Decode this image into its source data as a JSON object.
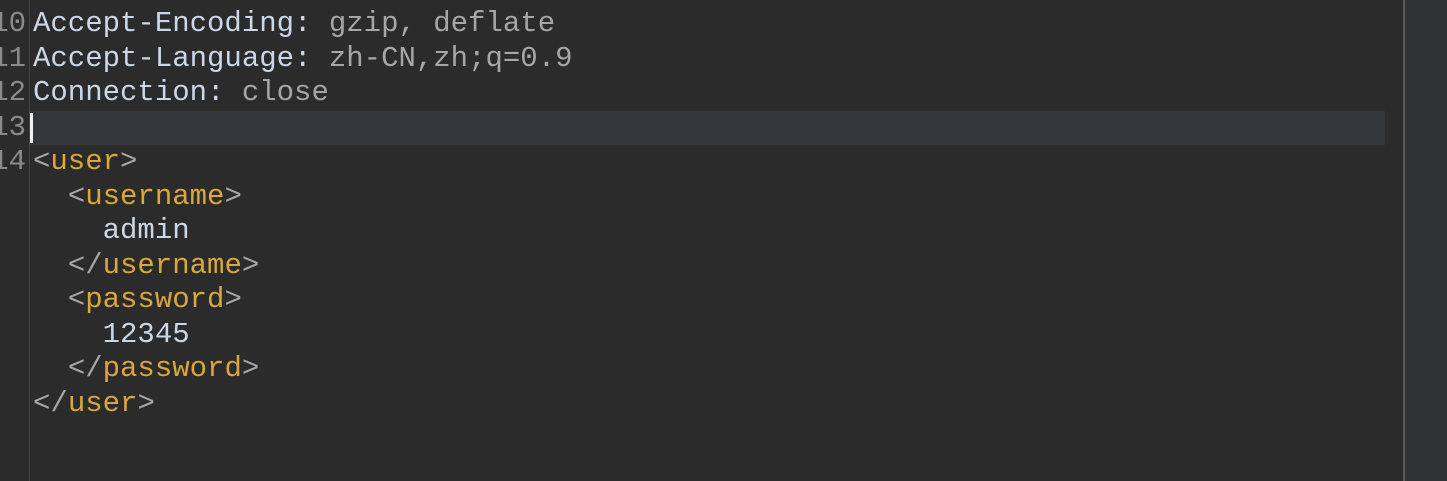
{
  "editor": {
    "line_numbers": [
      "10",
      "11",
      "12",
      "13",
      "14"
    ],
    "headers": [
      {
        "key": "Accept-Encoding:",
        "value": "gzip, deflate"
      },
      {
        "key": "Accept-Language:",
        "value": "zh-CN,zh;q=0.9"
      },
      {
        "key": "Connection:",
        "value": "close"
      }
    ],
    "xml": {
      "root_tag": "user",
      "username_tag": "username",
      "username_value": "admin",
      "password_tag": "password",
      "password_value": "12345"
    },
    "colors": {
      "background": "#2b2b2b",
      "tag": "#d9a73a",
      "current_line": "#33373a"
    }
  }
}
